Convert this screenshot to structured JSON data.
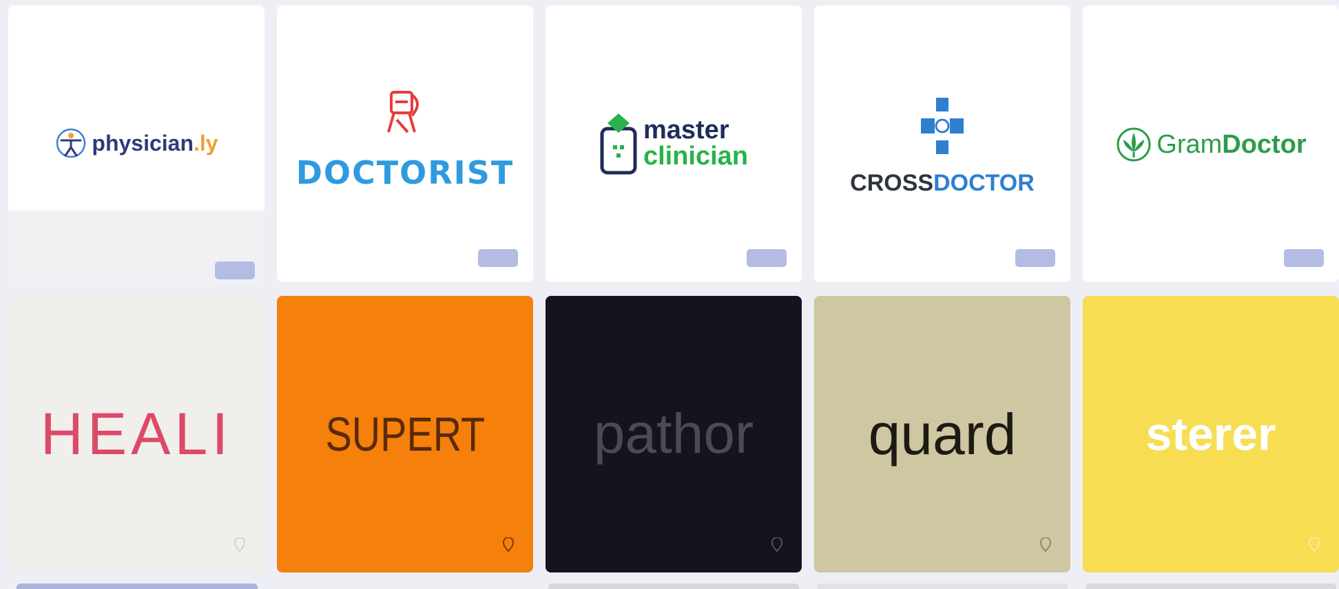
{
  "cards": [
    {
      "name": "physician.ly",
      "part1": "physician",
      "part2": ".ly",
      "badge": "",
      "colors": {
        "text": "#2e3a7a",
        "accent": "#f0a030",
        "icon": "#3b7fd6"
      }
    },
    {
      "name": "DOCTORIST",
      "wordmark": "DOCTORIST",
      "badge": "",
      "colors": {
        "text": "#2f9ae0",
        "icon": "#e83a3a"
      }
    },
    {
      "name": "master clinician",
      "line1": "master",
      "line2": "clinician",
      "badge": "",
      "colors": {
        "line1": "#1e2d5a",
        "line2": "#28b24a",
        "icon": "#1e2d5a"
      }
    },
    {
      "name": "CROSSDOCTOR",
      "part1": "CROSS",
      "part2": "DOCTOR",
      "badge": "",
      "colors": {
        "part1": "#2f3440",
        "part2": "#2f7fd0",
        "icon": "#2f7fd0"
      }
    },
    {
      "name": "GramDoctor",
      "part1": "Gram",
      "part2": "Doctor",
      "badge": "",
      "colors": {
        "text": "#2d9c4a",
        "icon": "#2d9c4a"
      }
    }
  ],
  "tiles": [
    {
      "name": "HEALI",
      "text": "HEALI",
      "bg": "#f1efec",
      "fg": "#dc4a68"
    },
    {
      "name": "SUPERT",
      "text": "SUPERT",
      "bg": "#f5800b",
      "fg": "#5a2a08"
    },
    {
      "name": "pathor",
      "text": "pathor",
      "bg": "#16131f",
      "fg": "#4d4a57"
    },
    {
      "name": "quard",
      "text": "quard",
      "bg": "#cfc6a2",
      "fg": "#1d1a12"
    },
    {
      "name": "sterer",
      "text": "sterer",
      "bg": "#f7dd52",
      "fg": "#ffffff"
    }
  ]
}
